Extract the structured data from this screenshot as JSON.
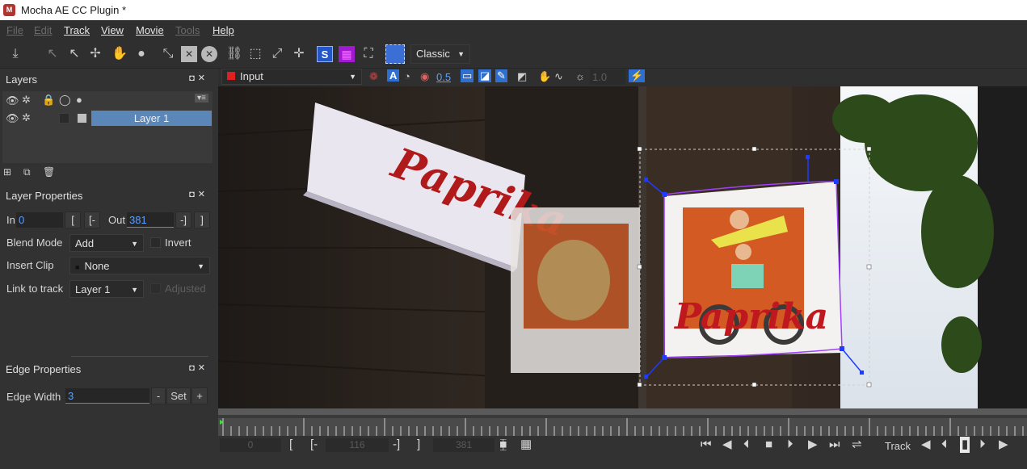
{
  "window": {
    "title": "Mocha AE CC Plugin *",
    "logo_letter": "M"
  },
  "menu": [
    {
      "label": "File",
      "enabled": false
    },
    {
      "label": "Edit",
      "enabled": false
    },
    {
      "label": "Track",
      "enabled": true
    },
    {
      "label": "View",
      "enabled": true
    },
    {
      "label": "Movie",
      "enabled": true
    },
    {
      "label": "Tools",
      "enabled": false
    },
    {
      "label": "Help",
      "enabled": true
    }
  ],
  "toolbar": {
    "workspace_value": "Classic",
    "icons": [
      "import-icon",
      "select-icon",
      "select-point-icon",
      "add-point-icon",
      "hand-icon",
      "zoom-icon",
      "transform-icon",
      "rectangle-icon",
      "circle-icon",
      "link-icon",
      "spline-icon",
      "scale-icon",
      "move-icon",
      "surface-icon",
      "grid-icon",
      "fit-icon",
      "rect-select-icon"
    ]
  },
  "layers_panel": {
    "title": "Layers",
    "layers": [
      {
        "name": "Layer 1",
        "selected": true
      }
    ]
  },
  "layer_properties": {
    "title": "Layer Properties",
    "in_label": "In",
    "in_value": "0",
    "in_btn1": "[",
    "in_btn2": "[-",
    "out_label": "Out",
    "out_value": "381",
    "out_btn1": "-]",
    "out_btn2": "]",
    "blend_mode_label": "Blend Mode",
    "blend_mode_value": "Add",
    "invert_label": "Invert",
    "insert_clip_label": "Insert Clip",
    "insert_clip_value": "None",
    "link_to_track_label": "Link to track",
    "link_to_track_value": "Layer 1",
    "adjusted_label": "Adjusted"
  },
  "edge_properties": {
    "title": "Edge Properties",
    "edge_width_label": "Edge Width",
    "edge_width_value": "3",
    "minus_label": "-",
    "set_label": "Set",
    "plus_label": "+"
  },
  "viewer": {
    "clip_value": "Input",
    "overlay_opacity": "0.5",
    "exposure_value": "1.0"
  },
  "playback": {
    "in_frame": "0",
    "current_frame": "116",
    "out_frame": "381",
    "bracket_in": "[",
    "bracket_in_dash": "[-",
    "bracket_out_dash": "-]",
    "bracket_out": "]",
    "track_label": "Track"
  },
  "image": {
    "sign_text": "Paprika"
  },
  "colors": {
    "accent": "#5b86b8",
    "input_red": "#e02020",
    "tracking_blue": "#1e3cff"
  }
}
